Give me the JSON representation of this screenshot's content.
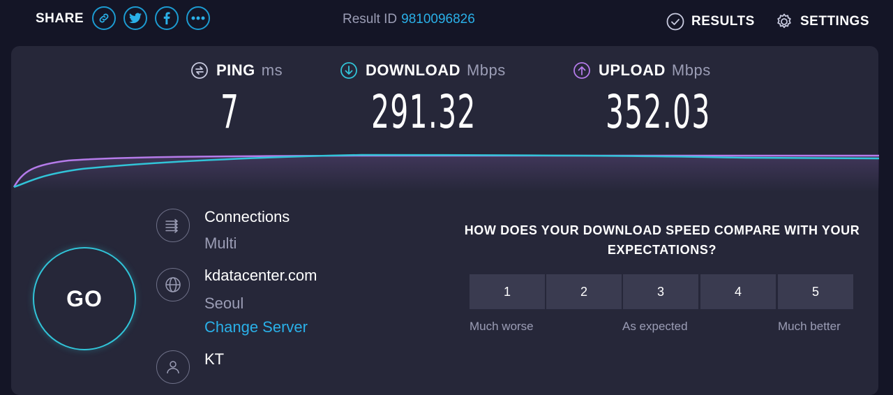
{
  "header": {
    "share_label": "SHARE",
    "share_icons": [
      "link-icon",
      "twitter-icon",
      "facebook-icon",
      "more-icon"
    ],
    "result_id_label": "Result ID",
    "result_id_value": "9810096826",
    "results_label": "RESULTS",
    "settings_label": "SETTINGS"
  },
  "metrics": {
    "ping": {
      "label": "PING",
      "unit": "ms",
      "value": "7",
      "icon": "ping-icon"
    },
    "download": {
      "label": "DOWNLOAD",
      "unit": "Mbps",
      "value": "291.32",
      "icon": "download-arrow-icon"
    },
    "upload": {
      "label": "UPLOAD",
      "unit": "Mbps",
      "value": "352.03",
      "icon": "upload-arrow-icon"
    }
  },
  "colors": {
    "accent_blue": "#2ab0e8",
    "download_cyan": "#31c4d8",
    "upload_purple": "#b57bea",
    "card_bg": "#262739",
    "page_bg": "#141526",
    "muted_text": "#9b9db5"
  },
  "go_button": {
    "label": "GO"
  },
  "connection_info": {
    "connections_label": "Connections",
    "connections_value": "Multi",
    "server_name": "kdatacenter.com",
    "server_location": "Seoul",
    "change_server_label": "Change Server",
    "provider": "KT"
  },
  "survey": {
    "question": "HOW DOES YOUR DOWNLOAD SPEED COMPARE WITH YOUR EXPECTATIONS?",
    "options": [
      "1",
      "2",
      "3",
      "4",
      "5"
    ],
    "low_label": "Much worse",
    "mid_label": "As expected",
    "high_label": "Much better"
  }
}
